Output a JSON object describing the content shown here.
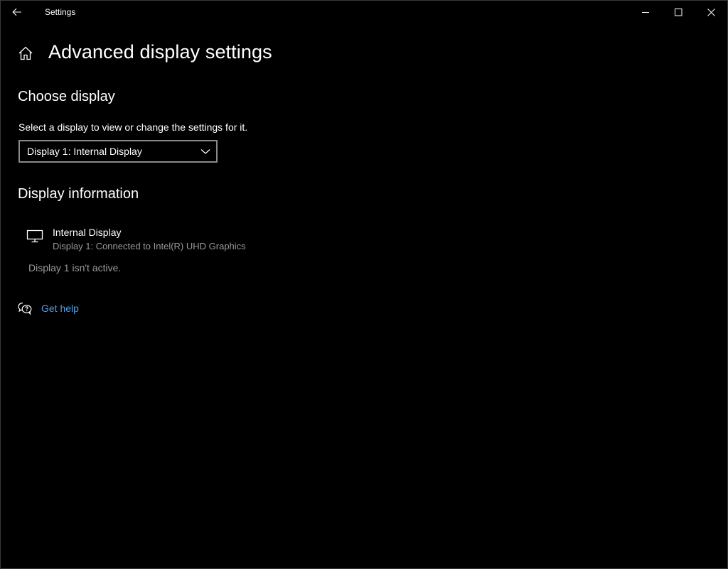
{
  "window": {
    "title": "Settings",
    "back_icon": "back-arrow-icon",
    "minimize_icon": "minimize-icon",
    "maximize_icon": "maximize-icon",
    "close_icon": "close-icon"
  },
  "header": {
    "home_icon": "home-icon",
    "title": "Advanced display settings"
  },
  "choose_display": {
    "title": "Choose display",
    "label": "Select a display to view or change the settings for it.",
    "selected": "Display 1: Internal Display"
  },
  "display_info": {
    "title": "Display information",
    "icon": "monitor-icon",
    "name": "Internal Display",
    "connection": "Display 1: Connected to Intel(R) UHD Graphics",
    "status": "Display 1 isn't active."
  },
  "help": {
    "icon": "help-chat-icon",
    "label": "Get help"
  },
  "colors": {
    "background": "#000000",
    "text": "#ffffff",
    "secondary_text": "#9a9a9a",
    "link": "#4f9ee8",
    "border": "#8a8a8a"
  }
}
